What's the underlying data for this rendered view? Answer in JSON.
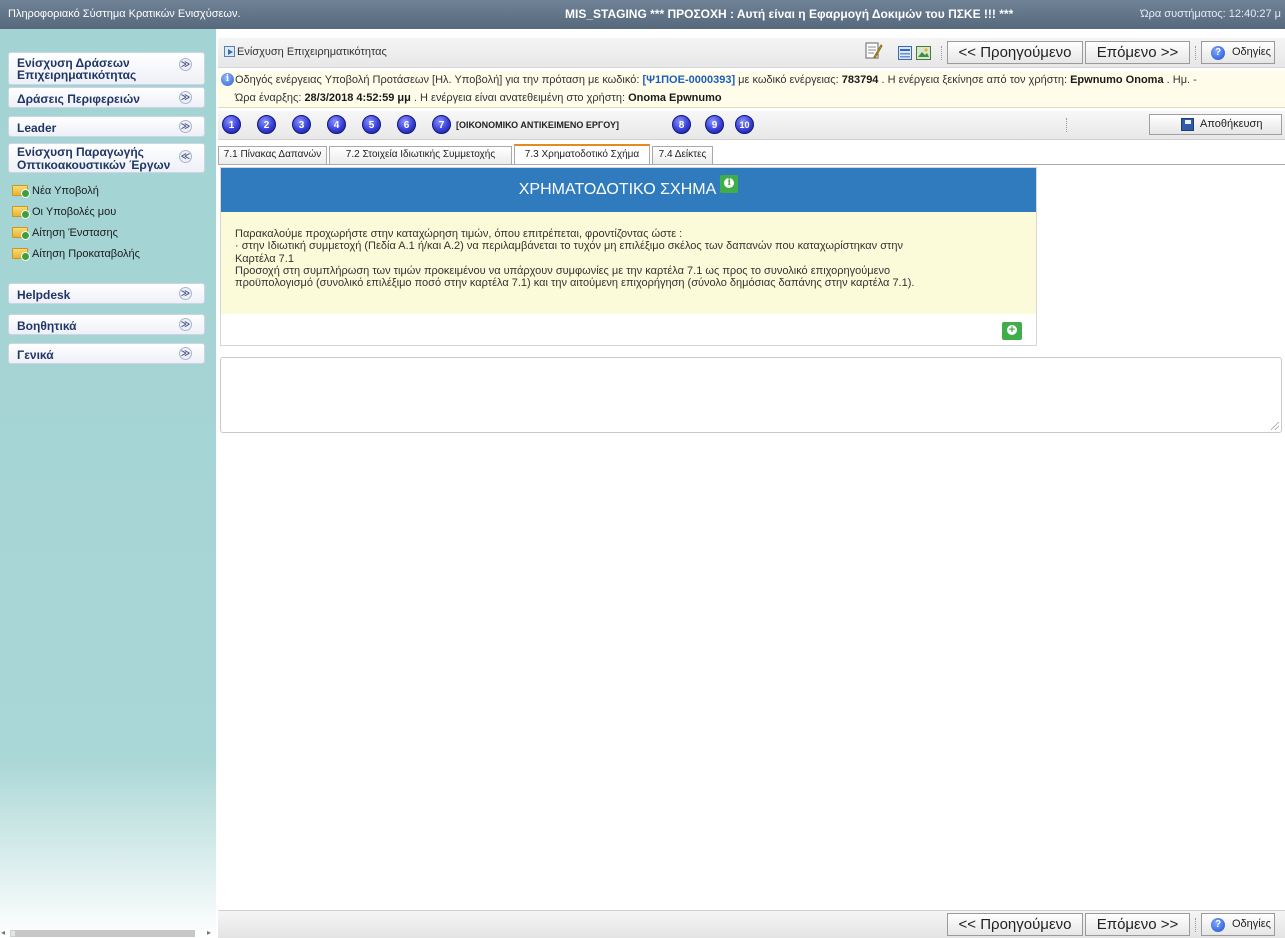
{
  "header": {
    "system_name": "Πληροφοριακό Σύστημα Κρατικών Ενισχύσεων.",
    "warning": "MIS_STAGING *** ΠΡΟΣΟΧΗ : Αυτή είναι η Εφαρμογή Δοκιμών του ΠΣΚΕ !!! ***",
    "clock": "Ώρα συστήματος: 12:40:27 μ"
  },
  "sidebar": {
    "sections": [
      {
        "label_line1": "Ενίσχυση Δράσεων",
        "label_line2": "Επιχειρηματικότητας",
        "state": "collapsed"
      },
      {
        "label_line1": "Δράσεις Περιφερειών",
        "label_line2": "",
        "state": "collapsed"
      },
      {
        "label_line1": "Leader",
        "label_line2": "",
        "state": "collapsed"
      },
      {
        "label_line1": "Ενίσχυση Παραγωγής",
        "label_line2": "Οπτικοακουστικών Έργων",
        "state": "expanded"
      },
      {
        "label_line1": "Helpdesk",
        "label_line2": "",
        "state": "collapsed"
      },
      {
        "label_line1": "Βοηθητικά",
        "label_line2": "",
        "state": "collapsed"
      },
      {
        "label_line1": "Γενικά",
        "label_line2": "",
        "state": "collapsed"
      }
    ],
    "items": [
      "Νέα Υποβολή",
      "Οι Υποβολές μου",
      "Αίτηση Ένστασης",
      "Αίτηση Προκαταβολής"
    ],
    "chevron_down": "≫",
    "chevron_up": "≪"
  },
  "toolbar": {
    "breadcrumb": "Ενίσχυση Επιχειρηματικότητας",
    "prev_label": "<< Προηγούμενο",
    "next_label": "Επόμενο >>",
    "help_label": "Οδηγίες"
  },
  "info": {
    "text_a": "Οδηγός ενέργειας Υποβολή Προτάσεων [Ηλ. Υποβολή] για την πρόταση με κωδικό: ",
    "proposal_code": "[Ψ1ΠΟΕ-0000393]",
    "text_b": " με κωδικό ενέργειας: ",
    "action_code": "783794",
    "text_c": " . Η ενέργεια ξεκίνησε από τον χρήστη: ",
    "user_start": "Epwnumo Onoma",
    "text_d": " . Ημ. -",
    "text_e": "Ώρα έναρξης: ",
    "start_time": "28/3/2018 4:52:59 μμ",
    "text_f": " . Η ενέργεια είναι ανατεθειμένη στο χρήστη: ",
    "user_assigned": "Onoma Epwnumo"
  },
  "steps": {
    "numbers": [
      "1",
      "2",
      "3",
      "4",
      "5",
      "6",
      "7",
      "8",
      "9",
      "10"
    ],
    "current_label": "[ΟΙΚΟΝΟΜΙΚΟ ΑΝΤΙΚΕΙΜΕΝΟ ΕΡΓΟΥ]",
    "save_label": "Αποθήκευση"
  },
  "tabs": [
    {
      "label": "7.1 Πίνακας Δαπανών",
      "active": false
    },
    {
      "label": "7.2 Στοιχεία Ιδιωτικής Συμμετοχής",
      "active": false
    },
    {
      "label": "7.3 Χρηματοδοτικό Σχήμα",
      "active": true
    },
    {
      "label": "7.4 Δείκτες",
      "active": false
    }
  ],
  "panel": {
    "title": "ΧΡΗΜΑΤΟΔΟΤΙΚΟ ΣΧΗΜΑ",
    "note_lines": [
      "Παρακαλούμε προχωρήστε στην καταχώρηση τιμών, όπου επιτρέπεται, φροντίζοντας ώστε :",
      "· στην Ιδιωτική συμμετοχή (Πεδία Α.1 ή/και Α.2) να περιλαμβάνεται το τυχόν μη επιλέξιμο σκέλος των δαπανών που καταχωρίστηκαν στην",
      "Καρτέλα 7.1",
      "Προσοχή στη συμπλήρωση των τιμών προκειμένου να υπάρχουν συμφωνίες με την καρτέλα 7.1 ως προς το συνολικό επιχορηγούμενο",
      "προϋπολογισμό (συνολικό επιλέξιμο ποσό στην καρτέλα 7.1) και την αιτούμενη επιχορήγηση (σύνολο δημόσιας δαπάνης στην καρτέλα 7.1)."
    ]
  },
  "colors": {
    "accent_blue": "#2f7bbd",
    "step_blue": "#3740d6",
    "active_tab": "#e58a1f",
    "add_green": "#3fae49",
    "sidebar_teal": "#a9d6d6"
  }
}
